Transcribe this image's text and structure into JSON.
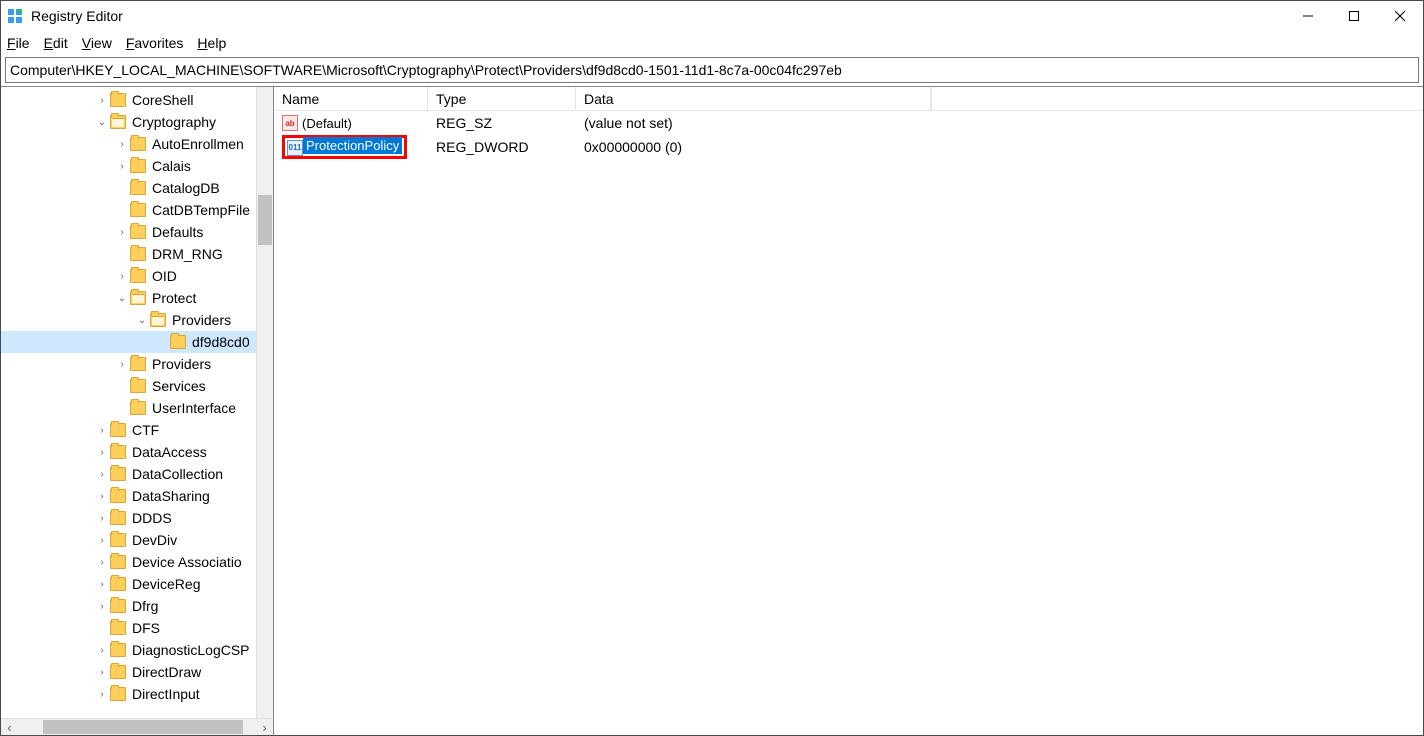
{
  "title": "Registry Editor",
  "menus": {
    "file": "File",
    "edit": "Edit",
    "view": "View",
    "favorites": "Favorites",
    "help": "Help"
  },
  "address": "Computer\\HKEY_LOCAL_MACHINE\\SOFTWARE\\Microsoft\\Cryptography\\Protect\\Providers\\df9d8cd0-1501-11d1-8c7a-00c04fc297eb",
  "tree": {
    "items": [
      {
        "indent": 0,
        "caret": "›",
        "label": "CoreShell",
        "open": false
      },
      {
        "indent": 0,
        "caret": "⌄",
        "label": "Cryptography",
        "open": true
      },
      {
        "indent": 1,
        "caret": "›",
        "label": "AutoEnrollmen",
        "open": false
      },
      {
        "indent": 1,
        "caret": "›",
        "label": "Calais",
        "open": false
      },
      {
        "indent": 1,
        "caret": "",
        "label": "CatalogDB",
        "open": false
      },
      {
        "indent": 1,
        "caret": "",
        "label": "CatDBTempFile",
        "open": false
      },
      {
        "indent": 1,
        "caret": "›",
        "label": "Defaults",
        "open": false
      },
      {
        "indent": 1,
        "caret": "",
        "label": "DRM_RNG",
        "open": false
      },
      {
        "indent": 1,
        "caret": "›",
        "label": "OID",
        "open": false
      },
      {
        "indent": 1,
        "caret": "⌄",
        "label": "Protect",
        "open": true
      },
      {
        "indent": 2,
        "caret": "⌄",
        "label": "Providers",
        "open": true
      },
      {
        "indent": 3,
        "caret": "",
        "label": "df9d8cd0",
        "open": false,
        "selected": true
      },
      {
        "indent": 1,
        "caret": "›",
        "label": "Providers",
        "open": false
      },
      {
        "indent": 1,
        "caret": "",
        "label": "Services",
        "open": false
      },
      {
        "indent": 1,
        "caret": "",
        "label": "UserInterface",
        "open": false
      },
      {
        "indent": 0,
        "caret": "›",
        "label": "CTF",
        "open": false
      },
      {
        "indent": 0,
        "caret": "›",
        "label": "DataAccess",
        "open": false
      },
      {
        "indent": 0,
        "caret": "›",
        "label": "DataCollection",
        "open": false
      },
      {
        "indent": 0,
        "caret": "›",
        "label": "DataSharing",
        "open": false
      },
      {
        "indent": 0,
        "caret": "›",
        "label": "DDDS",
        "open": false
      },
      {
        "indent": 0,
        "caret": "›",
        "label": "DevDiv",
        "open": false
      },
      {
        "indent": 0,
        "caret": "›",
        "label": "Device Associatio",
        "open": false
      },
      {
        "indent": 0,
        "caret": "›",
        "label": "DeviceReg",
        "open": false
      },
      {
        "indent": 0,
        "caret": "›",
        "label": "Dfrg",
        "open": false
      },
      {
        "indent": 0,
        "caret": "",
        "label": "DFS",
        "open": false
      },
      {
        "indent": 0,
        "caret": "›",
        "label": "DiagnosticLogCSP",
        "open": false
      },
      {
        "indent": 0,
        "caret": "›",
        "label": "DirectDraw",
        "open": false
      },
      {
        "indent": 0,
        "caret": "›",
        "label": "DirectInput",
        "open": false
      }
    ]
  },
  "list": {
    "headers": {
      "name": "Name",
      "type": "Type",
      "data": "Data"
    },
    "rows": [
      {
        "icon": "sz",
        "name": "(Default)",
        "type": "REG_SZ",
        "data": "(value not set)",
        "selected": false
      },
      {
        "icon": "dw",
        "name": "ProtectionPolicy",
        "type": "REG_DWORD",
        "data": "0x00000000 (0)",
        "selected": true
      }
    ]
  },
  "icon_text": {
    "sz": "ab",
    "dw": "011"
  }
}
